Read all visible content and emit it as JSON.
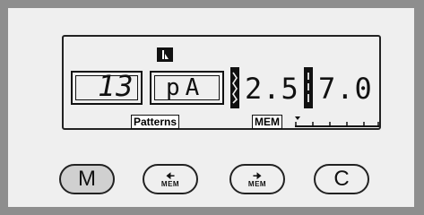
{
  "display": {
    "mode_icon": "presser-foot-icon",
    "pattern_number": "13",
    "pattern_code": "pA",
    "stitch_width": "2.5",
    "stitch_length": "7.0",
    "patterns_label": "Patterns",
    "memory_label": "MEM",
    "memory_level": 0.0
  },
  "buttons": {
    "mode_label": "M",
    "mem_back_label": "MEM",
    "mem_forward_label": "MEM",
    "clear_label": "C",
    "selected": "M"
  },
  "colors": {
    "frame": "#8e8e8e",
    "panel": "#efefef",
    "ink": "#111111",
    "selected_button": "#d0d0d0"
  }
}
